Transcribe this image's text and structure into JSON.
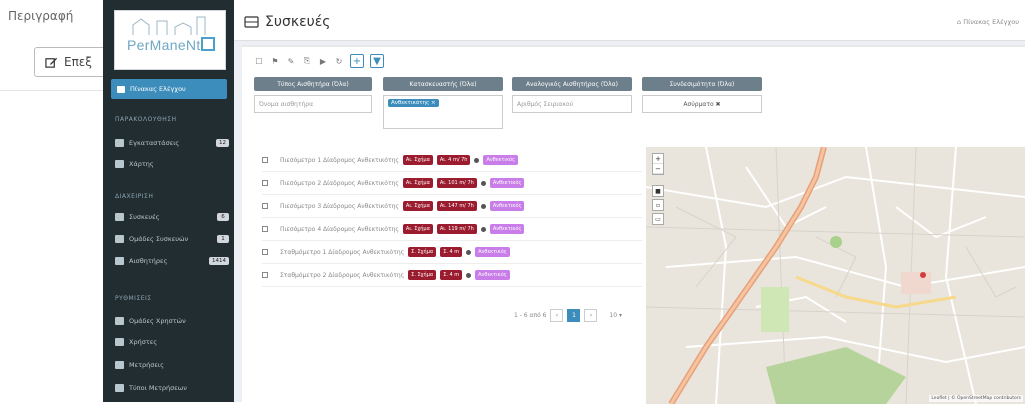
{
  "background_modal": {
    "field_label": "Περιγραφή",
    "edit_button_label": "Επεξ"
  },
  "sidebar": {
    "logo_text": "PerManeNt",
    "active_item": "Πίνακας Ελέγχου",
    "sections": [
      {
        "header": "ΠΑΡΑΚΟΛΟΥΘΗΣΗ",
        "items": [
          {
            "label": "Εγκαταστάσεις",
            "badge": "12"
          },
          {
            "label": "Χάρτης",
            "badge": ""
          }
        ]
      },
      {
        "header": "ΔΙΑΧΕΙΡΙΣΗ",
        "items": [
          {
            "label": "Συσκευές",
            "badge": "6"
          },
          {
            "label": "Ομάδες Συσκευών",
            "badge": "1"
          },
          {
            "label": "Αισθητήρες",
            "badge": "1414"
          }
        ]
      },
      {
        "header": "ΡΥΘΜΙΣΕΙΣ",
        "items": [
          {
            "label": "Ομάδες Χρηστών",
            "badge": ""
          },
          {
            "label": "Χρήστες",
            "badge": ""
          },
          {
            "label": "Μετρήσεις",
            "badge": ""
          },
          {
            "label": "Τύποι Μετρήσεων",
            "badge": ""
          }
        ]
      }
    ]
  },
  "header": {
    "title": "Συσκευές",
    "breadcrumb": "Πίνακας Ελέγχου"
  },
  "filters": [
    {
      "head": "Τύπος Αισθητήρα (Όλα)",
      "placeholder": "Όνομα αισθητήρα",
      "tag": ""
    },
    {
      "head": "Κατασκευαστής (Όλα)",
      "placeholder": "",
      "tag": "Ανθεκτικότης ×"
    },
    {
      "head": "Αναλογικός Αισθητήρας (Όλα)",
      "placeholder": "Αριθμός Σειριακού",
      "tag": ""
    },
    {
      "head": "Συνδεσιμότητα (Όλα)",
      "placeholder": "",
      "tag": "Ασύρματο ✖"
    }
  ],
  "devices": [
    {
      "name": "Πιεσόμετρο 1 Δίαδρομος Ανθεκτικότης",
      "tag1": "Αι. Σχήμα",
      "tag2": "Αι. 4 m/ 7h",
      "tag3": "Ανθεκτικός"
    },
    {
      "name": "Πιεσόμετρο 2 Δίαδρομος Ανθεκτικότης",
      "tag1": "Αι. Σχήμα",
      "tag2": "Αι. 101 m/ 7h",
      "tag3": "Ανθεκτικός"
    },
    {
      "name": "Πιεσόμετρο 3 Δίαδρομος Ανθεκτικότης",
      "tag1": "Αι. Σχήμα",
      "tag2": "Αι. 147 m/ 7h",
      "tag3": "Ανθεκτικός"
    },
    {
      "name": "Πιεσόμετρο 4 Δίαδρομος Ανθεκτικότης",
      "tag1": "Αι. Σχήμα",
      "tag2": "Αι. 119 m/ 7h",
      "tag3": "Ανθεκτικός"
    },
    {
      "name": "Σταθμόμετρο 1 Δίαδρομος Ανθεκτικότης",
      "tag1": "Σ. Σχήμα",
      "tag2": "Σ. 4 m",
      "tag3": "Ανθεκτικός"
    },
    {
      "name": "Σταθμόμετρο 2 Δίαδρομος Ανθεκτικότης",
      "tag1": "Σ. Σχήμα",
      "tag2": "Σ. 4 m",
      "tag3": "Ανθεκτικός"
    }
  ],
  "pagination": {
    "summary": "1 - 6 από 6",
    "prev": "‹",
    "current": "1",
    "next": "›",
    "per_page": "10 ▾"
  },
  "map": {
    "zoom_in": "+",
    "zoom_out": "−",
    "attribution": "Leaflet | © OpenStreetMap contributors"
  }
}
